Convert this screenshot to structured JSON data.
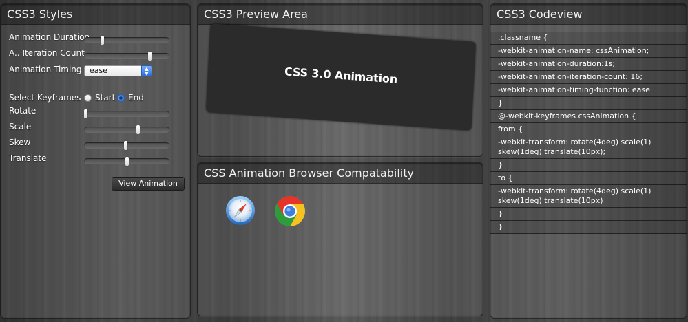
{
  "styles_panel": {
    "title": "CSS3 Styles",
    "labels": {
      "animation_duration": "Animation Duration",
      "iteration_count": "A.. Iteration Count",
      "animation_timing": "Animation Timing",
      "select_keyframes": "Select Keyframes",
      "rotate": "Rotate",
      "scale": "Scale",
      "skew": "Skew",
      "translate": "Translate"
    },
    "timing_selected": "ease",
    "keyframe_options": {
      "start": "Start",
      "end": "End",
      "selected": "End"
    },
    "slider_levels": {
      "animation_duration": 0.2,
      "iteration_count": 0.78,
      "rotate": 0.0,
      "scale": 0.64,
      "skew": 0.49,
      "translate": 0.5
    },
    "view_button": "View Animation"
  },
  "preview_panel": {
    "title": "CSS3 Preview Area",
    "text": "CSS 3.0 Animation"
  },
  "compat_panel": {
    "title": "CSS Animation Browser Compatability",
    "browsers": [
      "safari-icon",
      "chrome-icon"
    ]
  },
  "code_panel": {
    "title": "CSS3 Codeview",
    "lines": [
      ".classname {",
      "-webkit-animation-name: cssAnimation;",
      "-webkit-animation-duration:1s;",
      "-webkit-animation-iteration-count: 16;",
      "-webkit-animation-timing-function: ease",
      "}",
      "@-webkit-keyframes cssAnimation {",
      "from {",
      "-webkit-transform: rotate(4deg) scale(1) skew(1deg) translate(10px);",
      "}",
      "to {",
      "-webkit-transform: rotate(4deg) scale(1) skew(1deg) translate(10px)",
      "}",
      "}"
    ]
  },
  "colors": {
    "panel_text": "#ffffff",
    "select_accent": "#2c6fe0"
  }
}
